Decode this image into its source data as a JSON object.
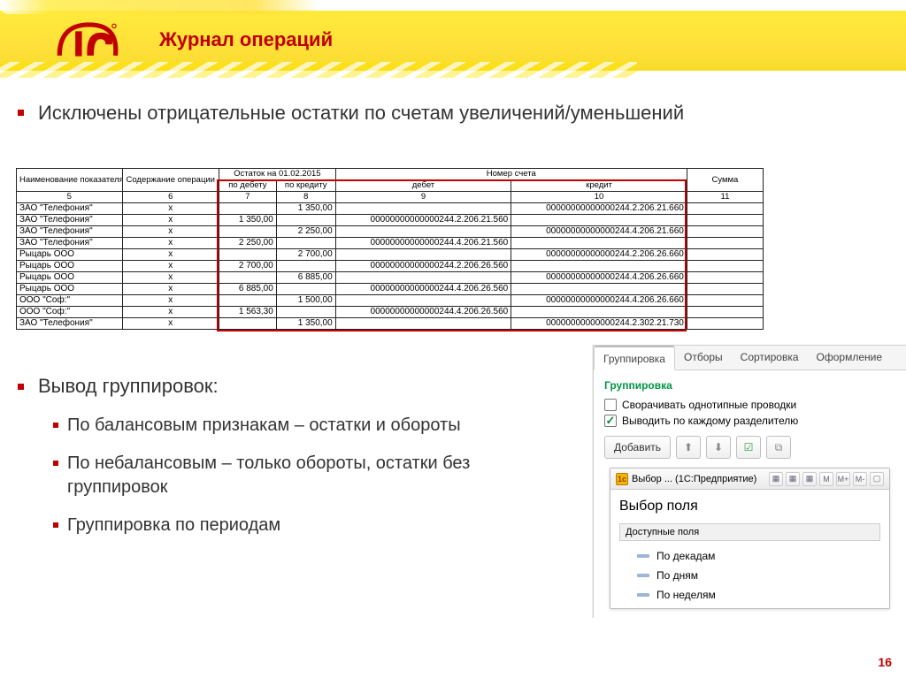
{
  "header": {
    "title": "Журнал операций"
  },
  "lead": "Исключены отрицательные остатки по счетам увеличений/уменьшений",
  "table": {
    "top": {
      "name": "Наименование показателя",
      "op": "Содержание операции",
      "balance_on": "Остаток на 01.02.2015",
      "acct": "Номер счета",
      "sum": "Сумма",
      "debit_col": "по дебету",
      "credit_col": "по кредиту",
      "debet": "дебет",
      "kredit": "кредит"
    },
    "colnums": [
      "5",
      "6",
      "7",
      "8",
      "9",
      "10",
      "11"
    ],
    "rows": [
      {
        "name": "ЗАО \"Телефония\"",
        "op": "x",
        "d": "",
        "k": "1 350,00",
        "db": "",
        "cr": "00000000000000244.2.206.21.660",
        "sum": ""
      },
      {
        "name": "ЗАО \"Телефония\"",
        "op": "x",
        "d": "1 350,00",
        "k": "",
        "db": "00000000000000244.2.206.21.560",
        "cr": "",
        "sum": ""
      },
      {
        "name": "ЗАО \"Телефония\"",
        "op": "x",
        "d": "",
        "k": "2 250,00",
        "db": "",
        "cr": "00000000000000244.4.206.21.660",
        "sum": ""
      },
      {
        "name": "ЗАО \"Телефония\"",
        "op": "x",
        "d": "2 250,00",
        "k": "",
        "db": "00000000000000244.4.206.21.560",
        "cr": "",
        "sum": ""
      },
      {
        "name": "Рыцарь ООО",
        "op": "x",
        "d": "",
        "k": "2 700,00",
        "db": "",
        "cr": "00000000000000244.2.206.26.660",
        "sum": ""
      },
      {
        "name": "Рыцарь ООО",
        "op": "x",
        "d": "2 700,00",
        "k": "",
        "db": "00000000000000244.2.206.26.560",
        "cr": "",
        "sum": ""
      },
      {
        "name": "Рыцарь ООО",
        "op": "x",
        "d": "",
        "k": "6 885,00",
        "db": "",
        "cr": "00000000000000244.4.206.26.660",
        "sum": ""
      },
      {
        "name": "Рыцарь ООО",
        "op": "x",
        "d": "6 885,00",
        "k": "",
        "db": "00000000000000244.4.206.26.560",
        "cr": "",
        "sum": ""
      },
      {
        "name": "ООО \"Соф:\"",
        "op": "x",
        "d": "",
        "k": "1 500,00",
        "db": "",
        "cr": "00000000000000244.4.206.26.660",
        "sum": ""
      },
      {
        "name": "ООО \"Соф:\"",
        "op": "x",
        "d": "1 563,30",
        "k": "",
        "db": "00000000000000244.4.206.26.560",
        "cr": "",
        "sum": ""
      },
      {
        "name": "ЗАО \"Телефония\"",
        "op": "x",
        "d": "",
        "k": "1 350,00",
        "db": "",
        "cr": "00000000000000244.2.302.21.730",
        "sum": ""
      }
    ]
  },
  "section2": {
    "heading": "Вывод группировок:",
    "items": [
      "По балансовым признакам – остатки и обороты",
      "По небалансовым – только обороты, остатки без группировок",
      "Группировка по периодам"
    ]
  },
  "panel": {
    "tabs": [
      "Группировка",
      "Отборы",
      "Сортировка",
      "Оформление"
    ],
    "group_title": "Группировка",
    "chk1": "Сворачивать однотипные проводки",
    "chk2": "Выводить по каждому разделителю",
    "add_btn": "Добавить",
    "subwin": {
      "caption": "Выбор ... (1С:Предприятие)",
      "heading": "Выбор поля",
      "tree_header": "Доступные поля",
      "items": [
        "По декадам",
        "По дням",
        "По неделям"
      ],
      "mini": [
        "▦",
        "▦",
        "▦",
        "M",
        "M+",
        "M-",
        "▢"
      ]
    }
  },
  "page_number": "16"
}
